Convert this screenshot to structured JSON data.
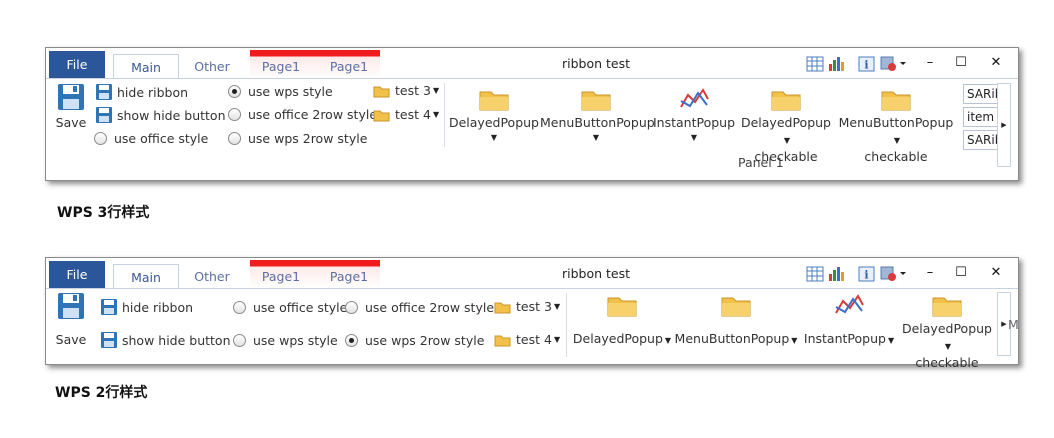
{
  "window1": {
    "file": "File",
    "tabs": {
      "main": "Main",
      "other": "Other",
      "page1a": "Page1",
      "page1b": "Page1"
    },
    "title": "ribbon test",
    "save": "Save",
    "hide_ribbon": "hide ribbon",
    "show_hide_button": "show hide button",
    "use_office_style": "use office style",
    "use_wps_style": "use wps style",
    "use_office_2row_style": "use office 2row style",
    "use_wps_2row_style": "use wps 2row style",
    "test3": "test 3",
    "test4": "test 4",
    "delayed_popup": "DelayedPopup",
    "menu_button_popup": "MenuButtonPopup",
    "instant_popup": "InstantPopup",
    "delayed_popup_checkable_1": "DelayedPopup",
    "delayed_popup_checkable_2": "checkable",
    "menu_button_popup_checkable_1": "MenuButtonPopup",
    "menu_button_popup_checkable_2": "checkable",
    "panel1": "Panel 1",
    "sa_ribbon_1": "SARib",
    "item": "item",
    "sa_ribbon_2": "SARib"
  },
  "caption1": "WPS 3行样式",
  "window2": {
    "file": "File",
    "tabs": {
      "main": "Main",
      "other": "Other",
      "page1a": "Page1",
      "page1b": "Page1"
    },
    "title": "ribbon test",
    "save": "Save",
    "hide_ribbon": "hide ribbon",
    "show_hide_button": "show hide button",
    "use_office_style": "use office style",
    "use_office_2row_style": "use office 2row style",
    "use_wps_style": "use wps style",
    "use_wps_2row_style": "use wps 2row style",
    "test3": "test 3",
    "test4": "test 4",
    "delayed_popup": "DelayedPopup",
    "menu_button_popup": "MenuButtonPopup",
    "instant_popup": "InstantPopup",
    "delayed_popup_checkable_1": "DelayedPopup",
    "delayed_popup_checkable_2": "checkable",
    "overflow_letter": "M"
  },
  "caption2": "WPS 2行样式",
  "selected_style": {
    "window1": "use wps style",
    "window2": "use wps 2row style"
  },
  "colors": {
    "file_button": "#2b579a",
    "context_tab": "#ee1c1c",
    "folder": "#f3c04a",
    "save_icon": "#2f74b5"
  },
  "icons": [
    "save-icon",
    "floppy-icon",
    "folder-icon",
    "chart-icon",
    "table-icon",
    "bar-chart-icon",
    "info-icon",
    "theme-icon"
  ]
}
